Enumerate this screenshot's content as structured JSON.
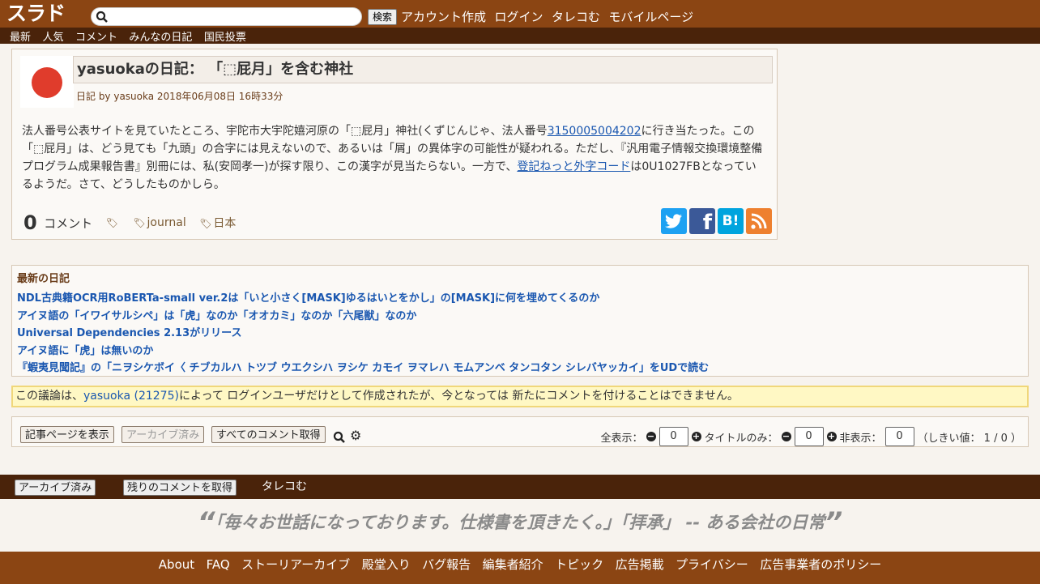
{
  "header": {
    "logo": "スラド",
    "search_placeholder": "",
    "search_button": "検索",
    "links": [
      "アカウント作成",
      "ログイン",
      "タレコむ",
      "モバイルページ"
    ]
  },
  "subnav": [
    "最新",
    "人気",
    "コメント",
    "みんなの日記",
    "国民投票"
  ],
  "article": {
    "title": "yasuokaの日記： 「⬚屁月」を含む神社",
    "byline": "日記 by yasuoka 2018年06月08日 16時33分",
    "body_1": "法人番号公表サイトを見ていたところ、宇陀市大宇陀嬉河原の「⬚屁月」神社(くずじんじゃ、法人番号",
    "body_link_1": "3150005004202",
    "body_2": "に行き当たった。この「⬚屁月」は、どう見ても「九頭」の合字には見えないので、あるいは「屑」の異体字の可能性が疑われる。ただし、『汎用電子情報交換環境整備プログラム成果報告書』別冊には、私(安岡孝一)が探す限り、この漢字が見当たらない。一方で、",
    "body_link_2": "登記ねっと外字コード",
    "body_3": "は0U1027FBとなっているようだ。さて、どうしたものかしら。",
    "comment_count": "0",
    "comment_label": "コメント",
    "tags": [
      "",
      "journal",
      "日本"
    ],
    "share": {
      "twitter": "t",
      "facebook": "f",
      "hatena": "B!",
      "rss": "rss"
    }
  },
  "recent": {
    "heading": "最新の日記",
    "items": [
      "NDL古典籍OCR用RoBERTa-small ver.2は「いと小さく[MASK]ゆるはいとをかし」の[MASK]に何を埋めてくるのか",
      "アイヌ語の「イワイサルシペ」は「虎」なのか「オオカミ」なのか「六尾獣」なのか",
      "Universal Dependencies 2.13がリリース",
      "アイヌ語に「虎」は無いのか",
      "『蝦夷見聞記』の「ニヲシケボイ〈 チブカルハ トツブ ウエクシハ ヲシケ カモイ ヲマレハ モムアンベ タンコタン シレバヤッカイ」をUDで読む"
    ]
  },
  "notice": {
    "prefix": "この議論は、",
    "user": "yasuoka (21275)",
    "suffix": "によって ログインユーザだけとして作成されたが、今となっては 新たにコメントを付けることはできません。"
  },
  "controls": {
    "view_article": "記事ページを表示",
    "archived": "アーカイブ済み",
    "get_all_comments": "すべてのコメント取得",
    "full_label": "全表示：",
    "full_value": "0",
    "title_only_label": "タイトルのみ：",
    "title_only_value": "0",
    "hidden_label": "非表示：",
    "hidden_value": "0",
    "threshold": "（しきい値： 1 / 0 ）"
  },
  "bottombar": {
    "archived": "アーカイブ済み",
    "get_rest": "残りのコメントを取得",
    "tarekomu": "タレコむ"
  },
  "quote": {
    "open": "“",
    "text": "「毎々お世話になっております。仕様書を頂きたく。」「拝承」 -- ある会社の日常",
    "close": "”"
  },
  "footer": [
    "About",
    "FAQ",
    "ストーリアーカイブ",
    "殿堂入り",
    "バグ報告",
    "編集者紹介",
    "トピック",
    "広告掲載",
    "プライバシー",
    "広告事業者のポリシー"
  ],
  "colors": {
    "brand": "#8b4513",
    "nav_dark": "#4a230a",
    "link": "#1a57b0",
    "notice_bg": "#fff8c4"
  }
}
